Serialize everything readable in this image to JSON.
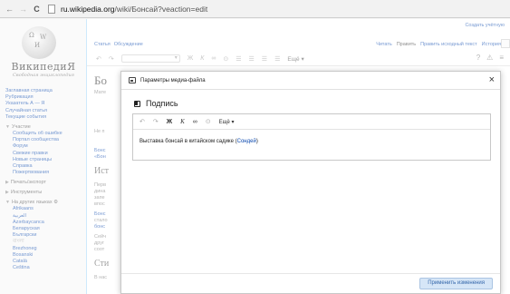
{
  "browser": {
    "url_domain": "ru.wikipedia.org",
    "url_path": "/wiki/Бонсай?veaction=edit"
  },
  "logo": {
    "title": "ВикипедиЯ",
    "subtitle": "Свободная энциклопедия"
  },
  "sidebar": {
    "nav": [
      "Заглавная страница",
      "Рубрикация",
      "Указатель А — Я",
      "Случайная статья",
      "Текущие события"
    ],
    "participation_head": "Участие",
    "participation": [
      "Сообщить об ошибке",
      "Портал сообщества",
      "Форум",
      "Свежие правки",
      "Новые страницы",
      "Справка",
      "Пожертвования"
    ],
    "print_head": "Печать/экспорт",
    "tools_head": "Инструменты",
    "lang_head": "На других языках",
    "languages": [
      "Afrikaans",
      "العربية",
      "Azərbaycanca",
      "Беларуская",
      "Български",
      "বাংলা",
      "Brezhoneg",
      "Bosanski",
      "Català",
      "Čeština"
    ]
  },
  "top": {
    "user_link": "Создать учётную"
  },
  "tabs": {
    "left": [
      "Статья",
      "Обсуждение"
    ],
    "right": [
      "Читать",
      "Править",
      "Править исходный текст",
      "История"
    ]
  },
  "ve_toolbar": {
    "bold": "Ж",
    "italic": "К",
    "more": "Ещё ▾"
  },
  "article": {
    "title": "Бо",
    "cut_text": [
      "Мате",
      "Не п",
      "Бонс",
      "«Бон",
      "Перв",
      "дина",
      "запе",
      "впос",
      "Бонс",
      "стало",
      "бонс",
      "Сейч",
      "друг",
      "соот",
      "В нас"
    ],
    "h2_1": "Ист",
    "h2_2": "Сти"
  },
  "dialog": {
    "title": "Параметры медиа-файла",
    "close": "×",
    "section_label": "Подпись",
    "toolbar_bold": "Ж",
    "toolbar_italic": "К",
    "toolbar_more": "Ещё ▾",
    "caption_text": "Выставка бонсай в китайском садике (",
    "caption_link": "Сондей",
    "caption_close": ")",
    "apply_label": "Применить изменения"
  }
}
